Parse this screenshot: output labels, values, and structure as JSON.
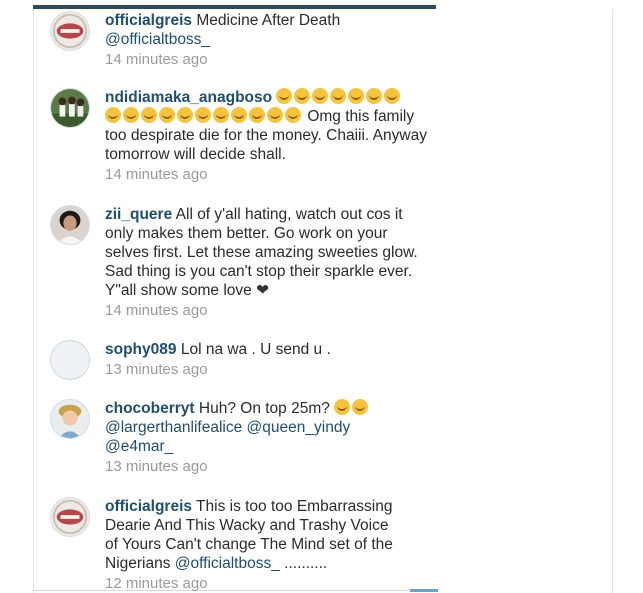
{
  "comments": [
    {
      "username": "officialgreis",
      "avatar": "lips-avatar",
      "text": "Medicine After Death",
      "mention": "@officialtboss_",
      "time": "14 minutes ago"
    },
    {
      "username": "ndidiamaka_anagboso",
      "avatar": "group-photo-avatar",
      "emoji_line1": 7,
      "emoji_line2": 11,
      "text": "Omg this family too despirate die for the money. Chaiii. Anyway tomorrow will decide shall.",
      "time": "14 minutes ago"
    },
    {
      "username": "zii_quere",
      "avatar": "portrait-avatar",
      "text": "All of y'all hating, watch out cos it only makes them better. Go work on your selves first. Let these amazing sweeties glow. Sad thing is you can't stop their sparkle ever. Y\"all show some love",
      "heart": "❤",
      "time": "14 minutes ago"
    },
    {
      "username": "sophy089",
      "avatar": "default-avatar",
      "text": "Lol na wa . U send u .",
      "time": "13 minutes ago"
    },
    {
      "username": "chocoberryt",
      "avatar": "child-avatar",
      "text": "Huh? On top 25m?",
      "emoji_count": 2,
      "mentions": [
        "@largerthanlifealice",
        "@queen_yindy",
        "@e4mar_"
      ],
      "time": "13 minutes ago"
    },
    {
      "username": "officialgreis",
      "avatar": "lips-avatar",
      "text": "This is too too Embarrassing Dearie And This Wacky and Trashy Voice of Yours Can't change The Mind set of the Nigerians",
      "mention": "@officialtboss_",
      "trail": " ..........",
      "time": "12 minutes ago"
    }
  ]
}
